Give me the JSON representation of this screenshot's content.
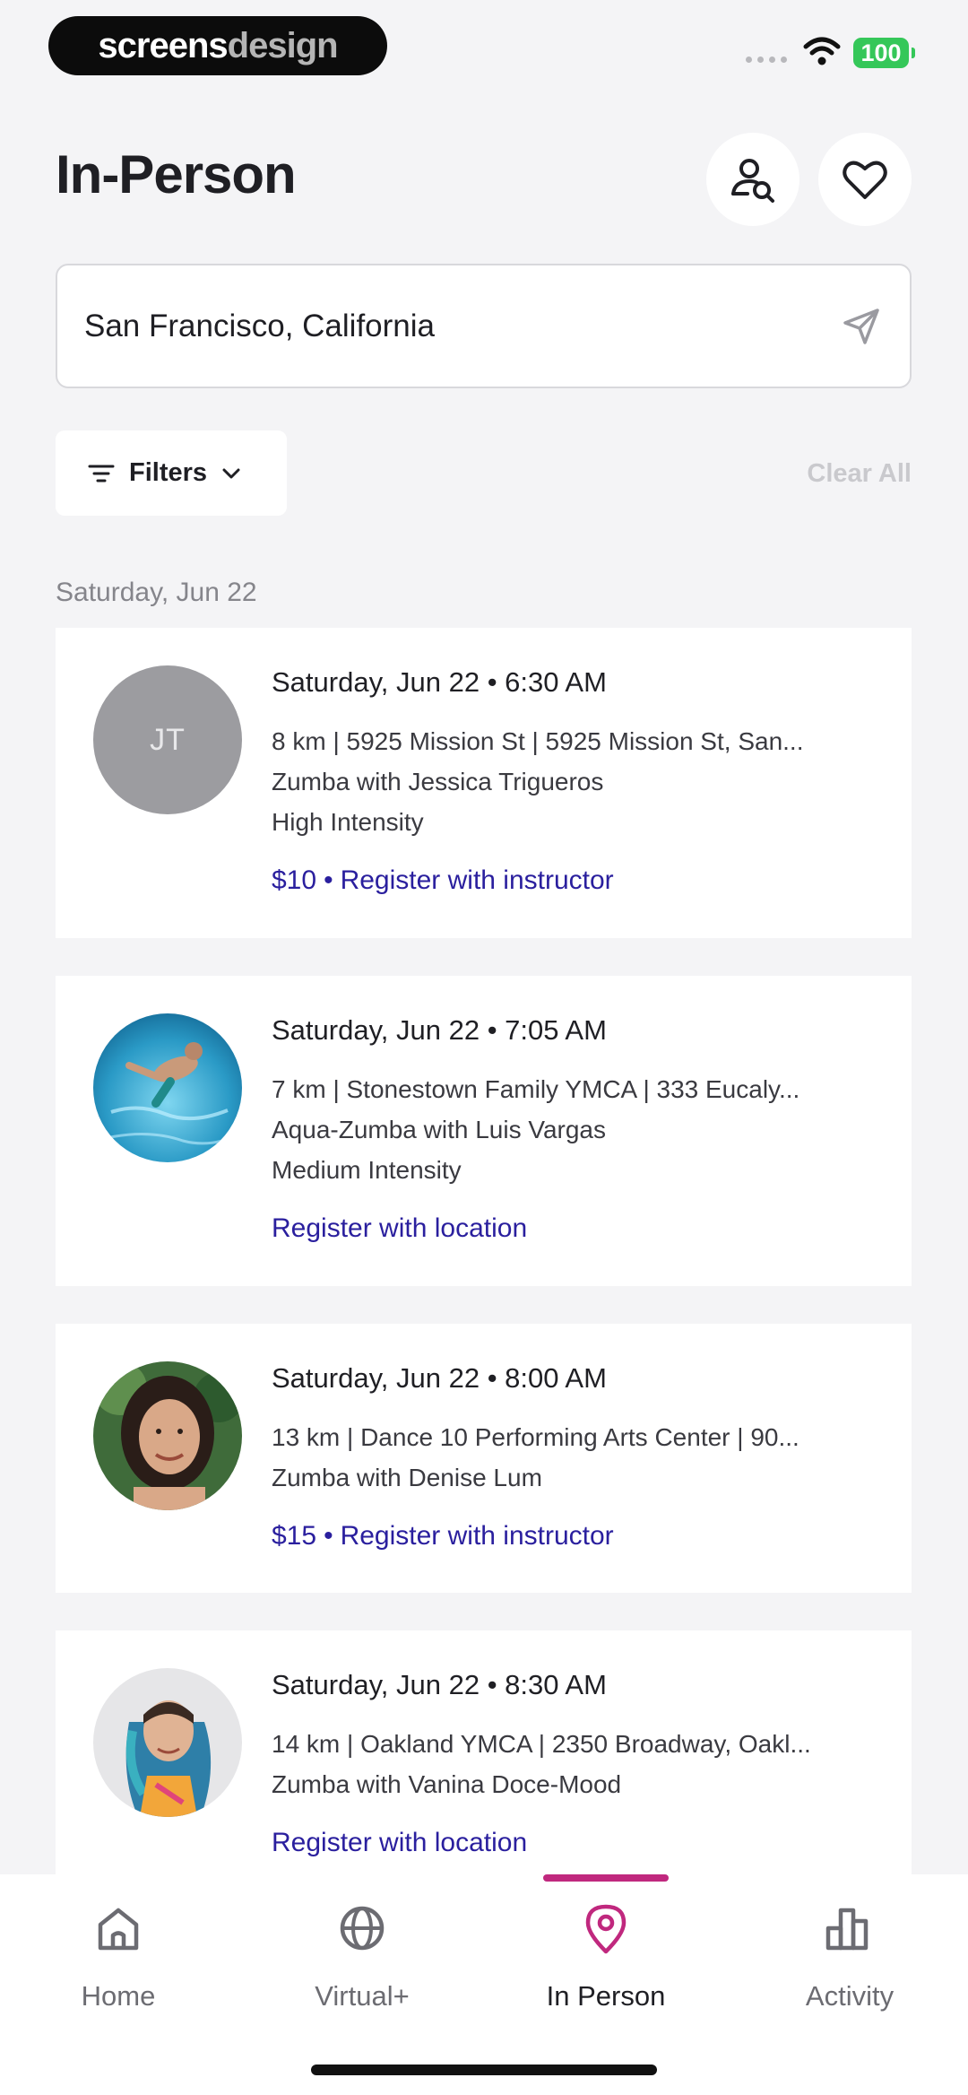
{
  "status_bar": {
    "brand_part1": "screens",
    "brand_part2": "design",
    "battery": "100"
  },
  "header": {
    "title": "In-Person",
    "search_instructor_icon": "person-search-icon",
    "favorites_icon": "heart-icon"
  },
  "location": {
    "value": "San Francisco, California",
    "icon": "navigation-arrow-icon"
  },
  "filters": {
    "label": "Filters",
    "clear_all": "Clear All"
  },
  "date_heading": "Saturday, Jun 22",
  "classes": [
    {
      "avatar_initials": "JT",
      "datetime": "Saturday, Jun 22 • 6:30 AM",
      "location": "8 km | 5925 Mission St | 5925 Mission St, San...",
      "title": "Zumba with Jessica Trigueros",
      "intensity": "High Intensity",
      "price": "$10",
      "cta": "Register with instructor"
    },
    {
      "avatar_initials": "",
      "datetime": "Saturday, Jun 22 • 7:05 AM",
      "location": "7 km | Stonestown Family YMCA | 333 Eucaly...",
      "title": "Aqua-Zumba with Luis Vargas",
      "intensity": "Medium Intensity",
      "price": "",
      "cta": "Register with location"
    },
    {
      "avatar_initials": "",
      "datetime": "Saturday, Jun 22 • 8:00 AM",
      "location": "13 km | Dance 10 Performing Arts Center | 90...",
      "title": "Zumba with Denise Lum",
      "intensity": "",
      "price": "$15",
      "cta": "Register with instructor"
    },
    {
      "avatar_initials": "",
      "datetime": "Saturday, Jun 22 • 8:30 AM",
      "location": "14 km | Oakland YMCA | 2350 Broadway, Oakl...",
      "title": "Zumba with Vanina Doce-Mood",
      "intensity": "",
      "price": "",
      "cta": "Register with location"
    }
  ],
  "tabs": [
    {
      "label": "Home",
      "icon": "home-icon",
      "active": false
    },
    {
      "label": "Virtual+",
      "icon": "globe-icon",
      "active": false
    },
    {
      "label": "In Person",
      "icon": "map-pin-icon",
      "active": true
    },
    {
      "label": "Activity",
      "icon": "bar-chart-icon",
      "active": false
    }
  ],
  "colors": {
    "background": "#f4f4f6",
    "link": "#2a1f9e",
    "active_tab_accent": "#c0287e",
    "battery": "#35c759"
  }
}
